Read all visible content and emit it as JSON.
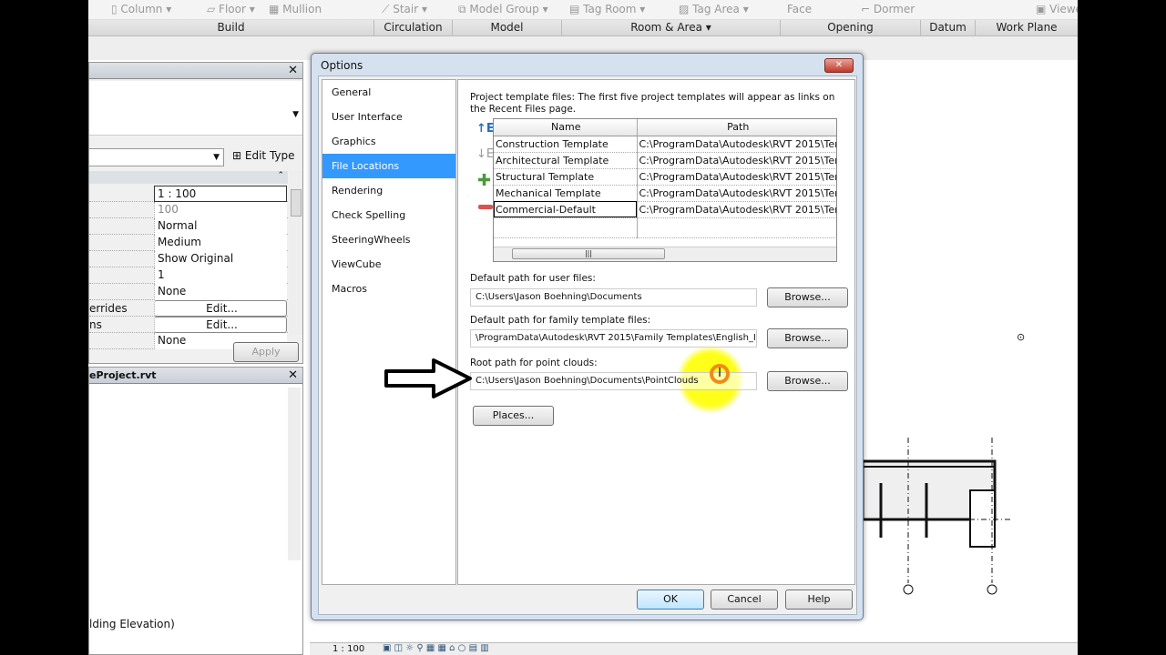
{
  "ribbon": {
    "tools": [
      "Column",
      "Floor",
      "Mullion",
      "Stair",
      "Model Group",
      "Tag Room",
      "Tag Area",
      "Face",
      "Dormer",
      "Viewer"
    ],
    "panels": [
      "Build",
      "Circulation",
      "Model",
      "Room & Area ▾",
      "Opening",
      "Datum",
      "Work Plane"
    ]
  },
  "properties": {
    "edit_type": "Edit Type",
    "apply": "Apply",
    "rows": [
      {
        "label": "",
        "value": "1 : 100"
      },
      {
        "label": "",
        "value": "100"
      },
      {
        "label": "",
        "value": "Normal"
      },
      {
        "label": "",
        "value": "Medium"
      },
      {
        "label": "",
        "value": "Show Original"
      },
      {
        "label": "",
        "value": "1"
      },
      {
        "label": "",
        "value": "None"
      },
      {
        "label": "errides",
        "value": "Edit..."
      },
      {
        "label": "ns",
        "value": "Edit..."
      },
      {
        "label": "",
        "value": "None"
      }
    ]
  },
  "browser": {
    "title": "eProject.rvt",
    "item": "lding Elevation)"
  },
  "status": {
    "scale": "1 : 100"
  },
  "dialog": {
    "title": "Options",
    "nav": [
      "General",
      "User Interface",
      "Graphics",
      "File Locations",
      "Rendering",
      "Check Spelling",
      "SteeringWheels",
      "ViewCube",
      "Macros"
    ],
    "selected_nav": "File Locations",
    "intro": "Project template files:  The first five project templates will appear as links on the Recent Files page.",
    "columns": [
      "Name",
      "Path"
    ],
    "templates": [
      {
        "name": "Construction Template",
        "path": "C:\\ProgramData\\Autodesk\\RVT 2015\\Ter"
      },
      {
        "name": "Architectural Template",
        "path": "C:\\ProgramData\\Autodesk\\RVT 2015\\Ter"
      },
      {
        "name": "Structural Template",
        "path": "C:\\ProgramData\\Autodesk\\RVT 2015\\Ter"
      },
      {
        "name": "Mechanical Template",
        "path": "C:\\ProgramData\\Autodesk\\RVT 2015\\Ter"
      },
      {
        "name": "Commercial-Default",
        "path": "C:\\ProgramData\\Autodesk\\RVT 2015\\Ter"
      }
    ],
    "user_files_label": "Default path for user files:",
    "user_files": "C:\\Users\\Jason Boehning\\Documents",
    "family_label": "Default path for family template files:",
    "family": "\\ProgramData\\Autodesk\\RVT 2015\\Family Templates\\English_I",
    "pointcloud_label": "Root path for point clouds:",
    "pointcloud": "C:\\Users\\Jason Boehning\\Documents\\PointClouds",
    "browse": "Browse...",
    "places": "Places...",
    "ok": "OK",
    "cancel": "Cancel",
    "help": "Help"
  },
  "colors": {
    "selection": "#3399ff",
    "highlight": "#ffff00"
  }
}
